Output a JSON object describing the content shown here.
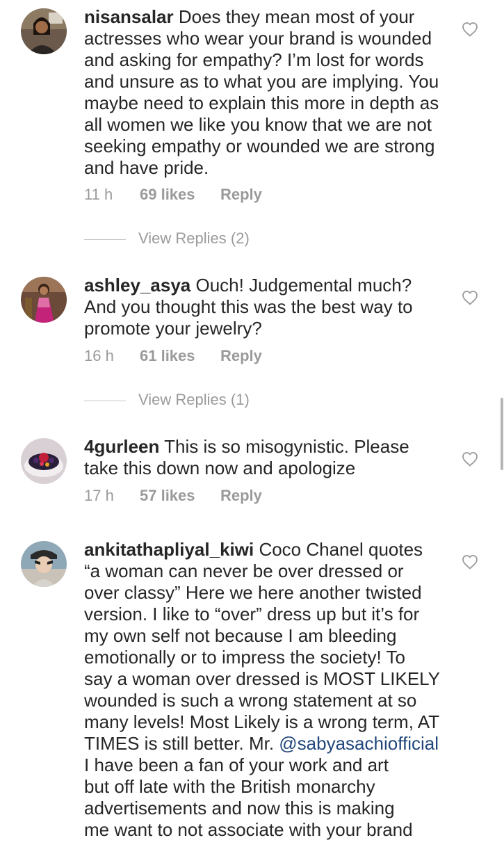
{
  "comments": [
    {
      "username": "nisansalar",
      "text": " Does they mean most of your\nactresses who wear your brand is wounded\nand asking for empathy? I’m lost for words\nand unsure as to what you are implying. You\nmaybe need to explain this more in depth as\nall women we like you know that we are not\nseeking empathy or wounded we are strong\nand have pride.",
      "time": "11 h",
      "likes": "69 likes",
      "reply": "Reply",
      "view_replies": "View Replies (2)"
    },
    {
      "username": "ashley_asya",
      "text": " Ouch! Judgemental much?\nAnd you thought this was the best way to\npromote your jewelry?",
      "time": "16 h",
      "likes": "61 likes",
      "reply": "Reply",
      "view_replies": "View Replies (1)"
    },
    {
      "username": "4gurleen",
      "text": " This is so misogynistic. Please\ntake this down now and apologize",
      "time": "17 h",
      "likes": "57 likes",
      "reply": "Reply"
    },
    {
      "username": "ankitathapliyal_kiwi",
      "text_before": " Coco Chanel quotes\n“a woman can never be over dressed or\nover classy” Here we here another twisted\nversion. I like to “over” dress up but it’s for\nmy own self not because I am bleeding\nemotionally or to impress the society! To\nsay a woman over dressed is MOST LIKELY\nwounded is such a wrong statement at so\nmany levels! Most Likely is a wrong term, AT\nTIMES is still better. Mr. ",
      "mention": "@sabyasachiofficial",
      "text_after": "\nI have been a fan of your work and art\nbut off late with the British monarchy\nadvertisements and now this is making\nme want to not associate with your brand"
    }
  ],
  "colors": {
    "text": "#262626",
    "meta": "#9a9a9a",
    "mention": "#20467c"
  },
  "icons": {
    "like": "heart-outline-icon"
  }
}
